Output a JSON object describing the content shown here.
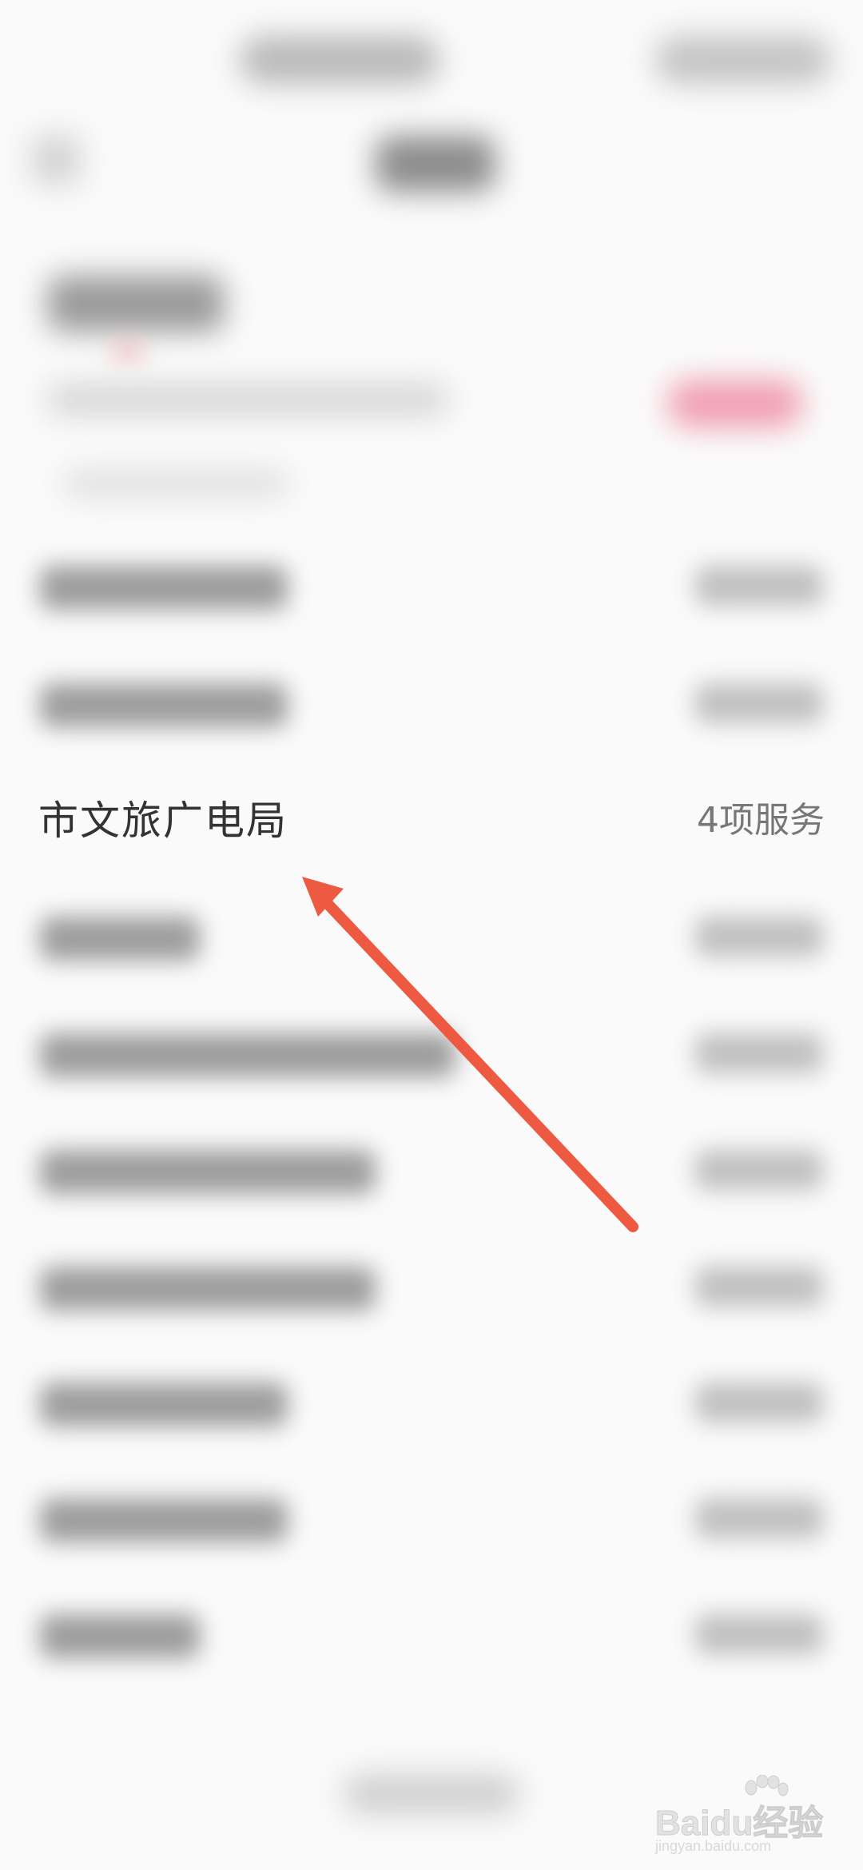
{
  "list": {
    "highlighted_item": {
      "title": "市文旅广电局",
      "meta": "4项服务"
    }
  },
  "annotation": {
    "arrow_color": "#ee5a41"
  },
  "watermark": {
    "brand": "Baidu经验",
    "url": "jingyan.baidu.com"
  }
}
